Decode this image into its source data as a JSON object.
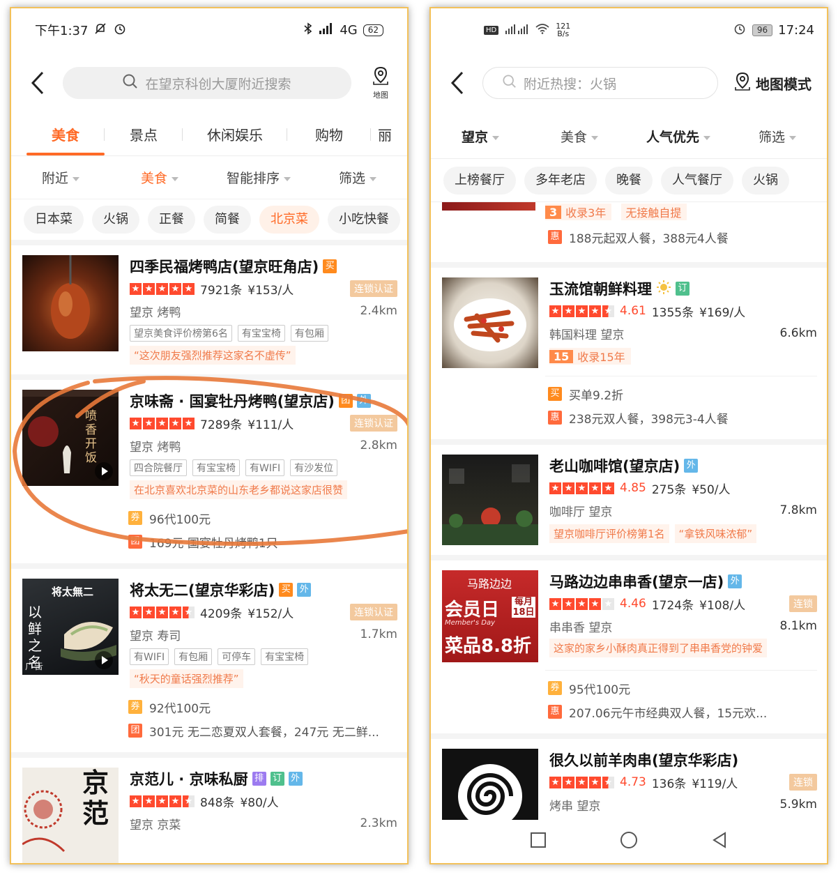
{
  "left": {
    "status": {
      "time": "下午1:37",
      "network": "4G",
      "battery": "62"
    },
    "search": {
      "placeholder": "在望京科创大厦附近搜索",
      "map_label": "地图"
    },
    "tabs": [
      "美食",
      "景点",
      "休闲娱乐",
      "购物",
      "丽"
    ],
    "filters": [
      "附近",
      "美食",
      "智能排序",
      "筛选"
    ],
    "chips": [
      "日本菜",
      "火锅",
      "正餐",
      "简餐",
      "北京菜",
      "小吃快餐"
    ],
    "shops": [
      {
        "name": "四季民福烤鸭店(望京旺角店)",
        "badges": [
          "买"
        ],
        "reviews": "7921条",
        "price": "¥153/人",
        "chain": "连锁认证",
        "area": "望京  烤鸭",
        "distance": "2.4km",
        "tags": [
          "望京美食评价榜第6名",
          "有宝宝椅",
          "有包厢"
        ],
        "rec": "“这次朋友强烈推荐这家名不虚传”"
      },
      {
        "name": "京味斋 · 国宴牡丹烤鸭(望京店)",
        "badges": [
          "团",
          "外"
        ],
        "reviews": "7289条",
        "price": "¥111/人",
        "chain": "连锁认证",
        "area": "望京  烤鸭",
        "distance": "2.8km",
        "tags": [
          "四合院餐厅",
          "有宝宝椅",
          "有WIFI",
          "有沙发位"
        ],
        "rec": "在北京喜欢北京菜的山东老乡都说这家店很赞",
        "promos": [
          {
            "icon": "券",
            "text": "96代100元"
          },
          {
            "icon": "团",
            "text": "169元 国宴牡丹烤鸭1只"
          }
        ]
      },
      {
        "name": "将太无二(望京华彩店)",
        "badges": [
          "买",
          "外"
        ],
        "reviews": "4209条",
        "price": "¥152/人",
        "chain": "连锁认证",
        "area": "望京  寿司",
        "distance": "1.7km",
        "tags": [
          "有WIFI",
          "有包厢",
          "可停车",
          "有宝宝椅"
        ],
        "rec": "“秋天的童话强烈推荐”",
        "ad": "广告",
        "promos": [
          {
            "icon": "券",
            "text": "92代100元"
          },
          {
            "icon": "团",
            "text": "301元 无二恋夏双人套餐，247元 无二鲜..."
          }
        ]
      },
      {
        "name": "京范儿 · 京味私厨",
        "badges": [
          "排",
          "订",
          "外"
        ],
        "reviews": "848条",
        "price": "¥80/人",
        "area": "望京  京菜",
        "distance": "2.3km"
      }
    ]
  },
  "right": {
    "status": {
      "time": "17:24",
      "speed": "121",
      "speed_unit": "B/s",
      "battery": "96"
    },
    "search": {
      "placeholder": "附近热搜：火锅",
      "map_label": "地图模式"
    },
    "filters": [
      "望京",
      "美食",
      "人气优先",
      "筛选"
    ],
    "chips": [
      "上榜餐厅",
      "多年老店",
      "晚餐",
      "人气餐厅",
      "火锅"
    ],
    "top_partial": {
      "year_num": "3",
      "year_text": "收录3年",
      "other_text": "无接触自提",
      "promo_icon": "惠",
      "promo": "188元起双人餐，388元4人餐"
    },
    "shops": [
      {
        "name": "玉流馆朝鲜料理",
        "badges": [
          "订"
        ],
        "score": "4.61",
        "reviews": "1355条",
        "price": "¥169/人",
        "area": "韩国料理  望京",
        "distance": "6.6km",
        "year_num": "15",
        "year_text": "收录15年",
        "promos": [
          {
            "icon": "买",
            "text": "买单9.2折"
          },
          {
            "icon": "惠",
            "text": "238元双人餐，398元3-4人餐"
          }
        ]
      },
      {
        "name": "老山咖啡馆(望京店)",
        "badges": [
          "外"
        ],
        "score": "4.85",
        "reviews": "275条",
        "price": "¥50/人",
        "area": "咖啡厅  望京",
        "distance": "7.8km",
        "tags": [
          "望京咖啡厅评价榜第1名",
          "“拿铁风味浓郁”"
        ]
      },
      {
        "name": "马路边边串串香(望京一店)",
        "badges": [
          "外"
        ],
        "score": "4.46",
        "reviews": "1724条",
        "price": "¥108/人",
        "chain": "连锁",
        "area": "串串香  望京",
        "distance": "8.1km",
        "rec": "这家的家乡小酥肉真正得到了串串香党的钟爱",
        "promos": [
          {
            "icon": "券",
            "text": "95代100元"
          },
          {
            "icon": "惠",
            "text": "207.06元午市经典双人餐，15元欢..."
          }
        ],
        "thumb_brand": "马路边边",
        "thumb_big": "会员日",
        "thumb_sub": "Member's Day",
        "thumb_date": "每月18日",
        "thumb_promo": "菜品8.8折"
      },
      {
        "name": "很久以前羊肉串(望京华彩店)",
        "score": "4.73",
        "reviews": "136条",
        "price": "¥119/人",
        "chain": "连锁",
        "area": "烤串  望京",
        "distance": "5.9km"
      }
    ]
  },
  "thumb_texts": {
    "peony": "喷香开饭",
    "jiangtai": "将太無二",
    "jiangtai_side": "以鲜之名",
    "jingfan": "京范"
  }
}
